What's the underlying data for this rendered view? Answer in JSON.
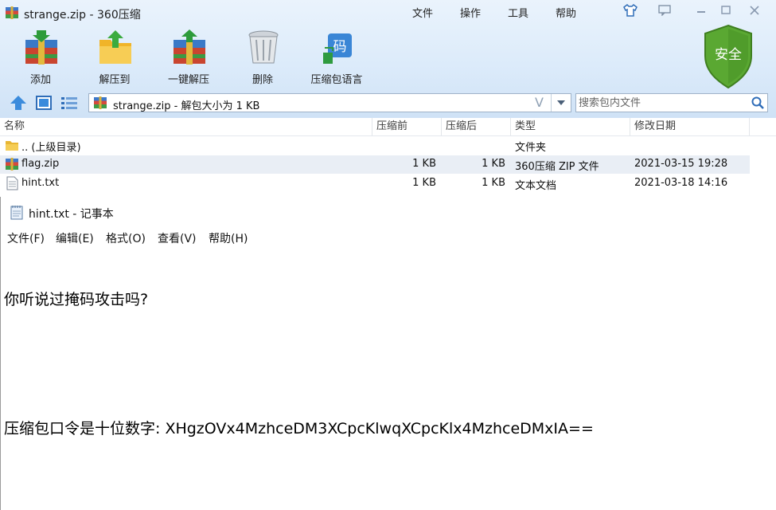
{
  "zip_window": {
    "title": "strange.zip - 360压缩",
    "menu": [
      "文件",
      "操作",
      "工具",
      "帮助"
    ],
    "toolbar": [
      {
        "label": "添加",
        "icon": "add-books-icon"
      },
      {
        "label": "解压到",
        "icon": "extract-folder-icon"
      },
      {
        "label": "一键解压",
        "icon": "one-click-extract-icon"
      },
      {
        "label": "删除",
        "icon": "trash-can-icon"
      },
      {
        "label": "压缩包语言",
        "icon": "archive-language-icon"
      }
    ],
    "security_badge": "安全",
    "address": "strange.zip - 解包大小为 1 KB",
    "search_placeholder": "搜索包内文件",
    "columns": [
      "名称",
      "压缩前",
      "压缩后",
      "类型",
      "修改日期"
    ],
    "rows": [
      {
        "name": ".. (上级目录)",
        "before": "",
        "after": "",
        "type": "文件夹",
        "date": ""
      },
      {
        "name": "flag.zip",
        "before": "1 KB",
        "after": "1 KB",
        "type": "360压缩 ZIP 文件",
        "date": "2021-03-15 19:28"
      },
      {
        "name": "hint.txt",
        "before": "1 KB",
        "after": "1 KB",
        "type": "文本文档",
        "date": "2021-03-18 14:16"
      }
    ]
  },
  "notepad": {
    "title": "hint.txt - 记事本",
    "menu": [
      "文件(F)",
      "编辑(E)",
      "格式(O)",
      "查看(V)",
      "帮助(H)"
    ],
    "lines": [
      "你听说过掩码攻击吗?",
      "",
      "压缩包口令是十位数字: XHgzOVx4MzhceDM3XCpcKlwqXCpcKlx4MzhceDMxIA=="
    ]
  },
  "colors": {
    "accent": "#2a7fd0",
    "chrome": "#dcebfa",
    "badge_green": "#4f9e2a"
  }
}
